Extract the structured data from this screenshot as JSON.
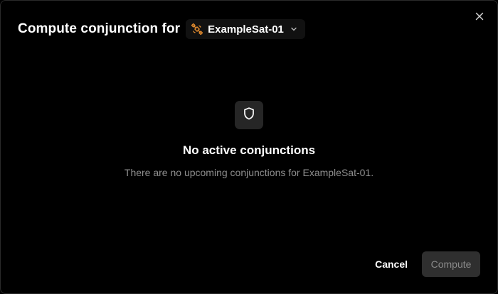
{
  "dialog": {
    "title": "Compute conjunction for",
    "satellite": {
      "name": "ExampleSat-01",
      "icon": "satellite-icon",
      "icon_color": "#e08a2e"
    },
    "close_icon": "close-icon"
  },
  "empty_state": {
    "icon": "shield-icon",
    "title": "No active conjunctions",
    "description": "There are no upcoming conjunctions for ExampleSat-01."
  },
  "footer": {
    "cancel_label": "Cancel",
    "compute_label": "Compute",
    "compute_disabled": true
  },
  "colors": {
    "background": "#000000",
    "muted_text": "#8f8f8f",
    "disabled_button": "#2f2f2f",
    "accent": "#e08a2e"
  }
}
